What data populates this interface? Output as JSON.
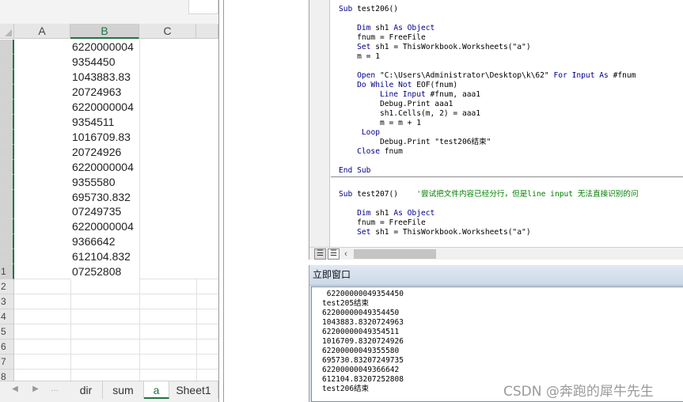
{
  "excel": {
    "columns": [
      "A",
      "B",
      "C"
    ],
    "row_numbers": [
      "1",
      "2",
      "3",
      "4",
      "5",
      "6",
      "7",
      "8"
    ],
    "column_b_values": [
      "6220000004",
      "9354450",
      "1043883.83",
      "20724963",
      "6220000004",
      "9354511",
      "1016709.83",
      "20724926",
      "6220000004",
      "9355580",
      "695730.832",
      "07249735",
      "6220000004",
      "9366642",
      "612104.832",
      "07252808"
    ],
    "sheet_tabs": [
      "dir",
      "sum",
      "a",
      "Sheet1"
    ],
    "active_sheet": "a",
    "accent_color": "#217346"
  },
  "code_window": {
    "lines": [
      {
        "parts": [
          {
            "t": "Sub",
            "k": "kw"
          },
          {
            "t": " test206()"
          }
        ]
      },
      {
        "parts": []
      },
      {
        "parts": [
          {
            "t": "    "
          },
          {
            "t": "Dim",
            "k": "kw"
          },
          {
            "t": " sh1 "
          },
          {
            "t": "As Object",
            "k": "kw"
          }
        ]
      },
      {
        "parts": [
          {
            "t": "    fnum = FreeFile"
          }
        ]
      },
      {
        "parts": [
          {
            "t": "    "
          },
          {
            "t": "Set",
            "k": "kw"
          },
          {
            "t": " sh1 = ThisWorkbook.Worksheets(\"a\")"
          }
        ]
      },
      {
        "parts": [
          {
            "t": "    m = 1"
          }
        ]
      },
      {
        "parts": []
      },
      {
        "parts": [
          {
            "t": "    "
          },
          {
            "t": "Open",
            "k": "kw"
          },
          {
            "t": " \"C:\\Users\\Administrator\\Desktop\\k\\62\" "
          },
          {
            "t": "For Input As",
            "k": "kw"
          },
          {
            "t": " #fnum"
          }
        ]
      },
      {
        "parts": [
          {
            "t": "    "
          },
          {
            "t": "Do While Not",
            "k": "kw"
          },
          {
            "t": " EOF(fnum)"
          }
        ]
      },
      {
        "parts": [
          {
            "t": "         "
          },
          {
            "t": "Line Input",
            "k": "kw"
          },
          {
            "t": " #fnum, aaa1"
          }
        ]
      },
      {
        "parts": [
          {
            "t": "         Debug.Print aaa1"
          }
        ]
      },
      {
        "parts": [
          {
            "t": "         sh1.Cells(m, 2) = aaa1"
          }
        ]
      },
      {
        "parts": [
          {
            "t": "         m = m + 1"
          }
        ]
      },
      {
        "parts": [
          {
            "t": "     "
          },
          {
            "t": "Loop",
            "k": "kw"
          }
        ]
      },
      {
        "parts": [
          {
            "t": "         Debug.Print \"test206结束\""
          }
        ]
      },
      {
        "parts": [
          {
            "t": "    "
          },
          {
            "t": "Close",
            "k": "kw"
          },
          {
            "t": " fnum"
          }
        ]
      },
      {
        "parts": []
      },
      {
        "parts": [
          {
            "t": "End Sub",
            "k": "kw"
          }
        ]
      },
      {
        "sep": true
      },
      {
        "parts": []
      },
      {
        "parts": [
          {
            "t": "Sub",
            "k": "kw"
          },
          {
            "t": " test207()    "
          },
          {
            "t": "'尝试把文件内容已经分行，但是line input 无法直接识别的问",
            "k": "cm"
          }
        ]
      },
      {
        "parts": []
      },
      {
        "parts": [
          {
            "t": "    "
          },
          {
            "t": "Dim",
            "k": "kw"
          },
          {
            "t": " sh1 "
          },
          {
            "t": "As Object",
            "k": "kw"
          }
        ]
      },
      {
        "parts": [
          {
            "t": "    fnum = FreeFile"
          }
        ]
      },
      {
        "parts": [
          {
            "t": "    "
          },
          {
            "t": "Set",
            "k": "kw"
          },
          {
            "t": " sh1 = ThisWorkbook.Worksheets(\"a\")"
          }
        ]
      }
    ],
    "keyword_color": "#00008b",
    "comment_color": "#008000"
  },
  "immediate_window": {
    "title": "立即窗口",
    "lines": [
      " 62200000049354450",
      "test205结束",
      "62200000049354450",
      "1043883.8320724963",
      "62200000049354511",
      "1016709.8320724926",
      "62200000049355580",
      "695730.83207249735",
      "62200000049366642",
      "612104.83207252808",
      "test206结束"
    ]
  },
  "watermark": "CSDN @奔跑的犀牛先生"
}
